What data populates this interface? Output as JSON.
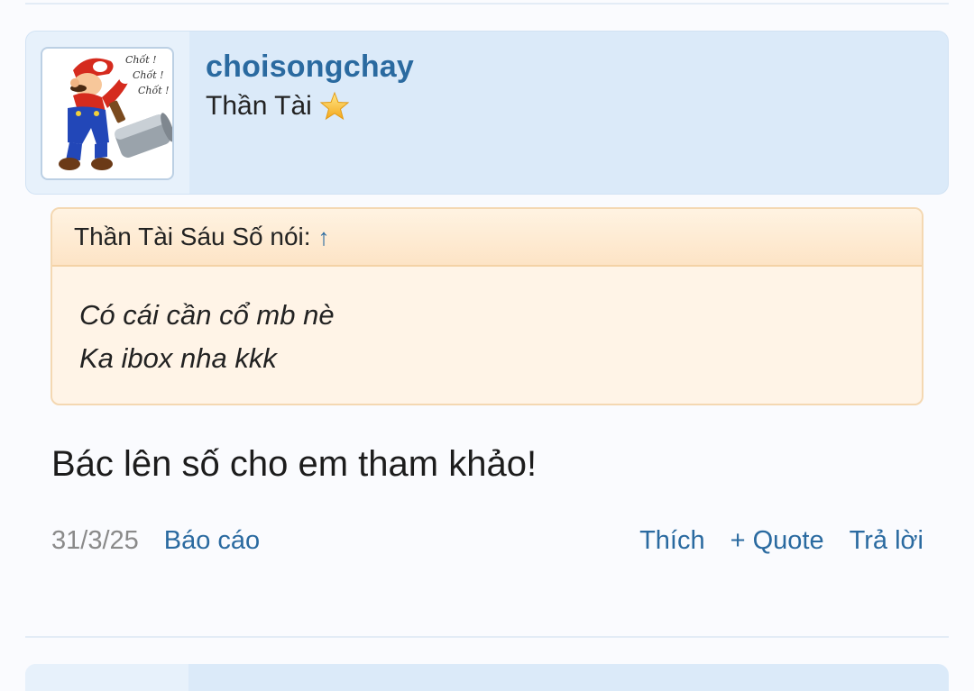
{
  "post": {
    "username": "choisongchay",
    "user_title": "Thần Tài",
    "avatar_caption": [
      "Chốt !",
      "Chốt !",
      "Chốt !"
    ],
    "quote": {
      "attribution": "Thần Tài Sáu Số nói:",
      "arrow": "↑",
      "lines": [
        "Có cái cần cổ mb nè",
        "Ka ibox nha kkk"
      ]
    },
    "message": "Bác lên số cho em tham khảo!",
    "date": "31/3/25",
    "actions": {
      "report": "Báo cáo",
      "like": "Thích",
      "quote": "+ Quote",
      "reply": "Trả lời"
    }
  },
  "colors": {
    "accent": "#2a6aa0",
    "header_bg": "#dbeaf9",
    "quote_bg": "#fff4e7",
    "quote_border": "#f4d8b2"
  },
  "icons": {
    "title_badge": "star-icon",
    "avatar": "mario-hammer-avatar"
  }
}
